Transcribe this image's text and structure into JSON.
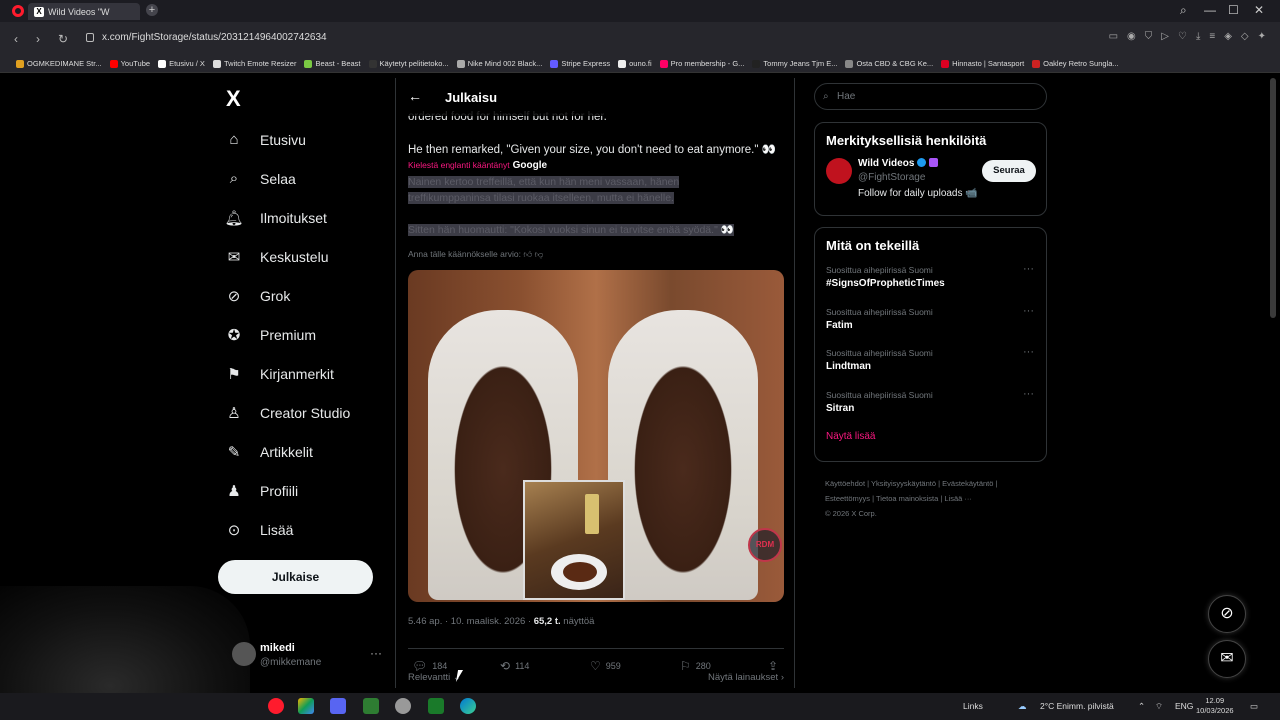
{
  "browser": {
    "tab_title": "Wild Videos \"W",
    "url": "x.com/FightStorage/status/2031214964002742634",
    "bookmarks": [
      "OGMKEDIMANE Str...",
      "YouTube",
      "Etusivu / X",
      "Twitch Emote Resizer",
      "Beast - Beast",
      "Käytetyt pelitietoko...",
      "Nike Mind 002 Black...",
      "Stripe Express",
      "ouno.fi",
      "Pro membership - G...",
      "Tommy Jeans Tjm E...",
      "Osta CBD & CBG Ke...",
      "Hinnasto | Santasport",
      "Oakley Retro Sungla..."
    ]
  },
  "nav": {
    "logo": "X",
    "items": [
      {
        "label": "Etusivu",
        "icon": "home-icon"
      },
      {
        "label": "Selaa",
        "icon": "search-icon"
      },
      {
        "label": "Ilmoitukset",
        "icon": "bell-icon"
      },
      {
        "label": "Keskustelu",
        "icon": "mail-icon"
      },
      {
        "label": "Grok",
        "icon": "grok-icon"
      },
      {
        "label": "Premium",
        "icon": "premium-icon"
      },
      {
        "label": "Kirjanmerkit",
        "icon": "bookmark-icon"
      },
      {
        "label": "Creator Studio",
        "icon": "creator-icon"
      },
      {
        "label": "Artikkelit",
        "icon": "article-icon"
      },
      {
        "label": "Profiili",
        "icon": "profile-icon"
      },
      {
        "label": "Lisää",
        "icon": "more-icon"
      }
    ],
    "post_label": "Julkaise",
    "account_name": "mikedi",
    "account_handle": "@mikkemane"
  },
  "post": {
    "header_title": "Julkaisu",
    "text_line1": "ordered food for himself but not for her.",
    "text_line2": "He then remarked, \"Given your size, you don't need to eat anymore.\" 👀",
    "translated_from": "Kielestä englanti kääntänyt",
    "translator": "Google",
    "translated_text_1": "Nainen kertoo treffeillä, että kun hän meni vassaan, hänen treffikumppaninsa tilasi ruokaa itselleen, mutta ei hänelle.",
    "translated_text_2": "Sitten hän huomautti: \"Kokosi vuoksi sinun ei tarvitse enää syödä.\" 👀",
    "rate_translation": "Anna tälle käännökselle arvio:",
    "watermark": "RDM",
    "time": "5.46 ap.",
    "date": "10. maalisk. 2026",
    "views_count": "65,2 t.",
    "views_label": "näyttöä",
    "replies": "184",
    "reposts": "114",
    "likes": "959",
    "bookmarks": "280",
    "sort_label": "Relevantti",
    "quotes_label": "Näytä lainaukset"
  },
  "sidebar": {
    "search_placeholder": "Hae",
    "who_title": "Merkityksellisiä henkilöitä",
    "who_name": "Wild Videos",
    "who_handle": "@FightStorage",
    "who_bio": "Follow for daily uploads 📹",
    "follow_label": "Seuraa",
    "trends_title": "Mitä on tekeillä",
    "trends": [
      {
        "context": "Suosittua aihepiirissä Suomi",
        "name": "#SignsOfPropheticTimes"
      },
      {
        "context": "Suosittua aihepiirissä Suomi",
        "name": "Fatim"
      },
      {
        "context": "Suosittua aihepiirissä Suomi",
        "name": "Lindtman"
      },
      {
        "context": "Suosittua aihepiirissä Suomi",
        "name": "Sitran"
      }
    ],
    "show_more": "Näytä lisää",
    "footer_1": "Käyttöehdot  |  Yksityisyyskäytäntö  |  Evästekäytäntö  |",
    "footer_2": "Esteettömyys  |  Tietoa mainoksista  |  Lisää ···",
    "footer_3": "© 2026 X Corp."
  },
  "taskbar": {
    "links": "Links",
    "weather": "2°C  Enimm. pilvistä",
    "lang": "ENG",
    "time": "12.09",
    "date": "10/03/2026"
  },
  "colors": {
    "accent": "#f91880",
    "verified": "#1d9bf0",
    "background": "#000000"
  }
}
